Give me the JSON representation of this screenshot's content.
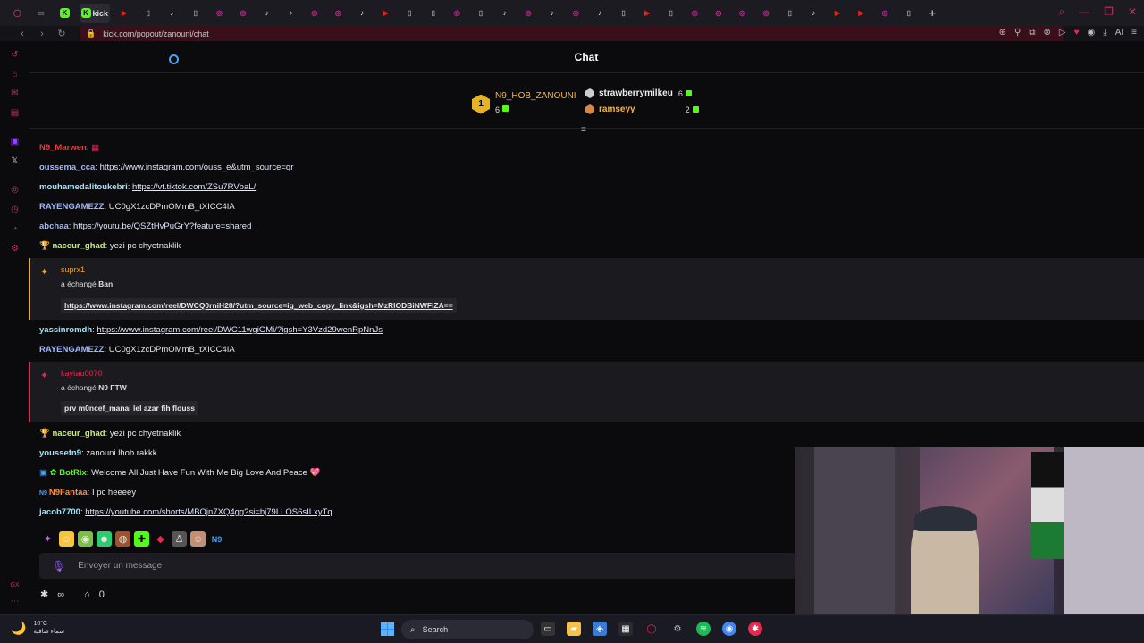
{
  "browser": {
    "active_tab_label": "kick",
    "url": "kick.com/popout/zanouni/chat",
    "tab_icons": [
      "opera-icon",
      "window-icon",
      "kick-icon",
      "kick-icon",
      "youtube-icon",
      "page-icon",
      "tiktok-icon",
      "page-icon",
      "instagram-icon",
      "instagram-icon",
      "tiktok-icon",
      "tiktok-icon",
      "instagram-icon",
      "instagram-icon",
      "tiktok-icon",
      "youtube-icon",
      "page-icon",
      "page-icon",
      "instagram-icon",
      "page-icon",
      "tiktok-icon",
      "instagram-icon",
      "tiktok-icon",
      "instagram-icon",
      "tiktok-icon",
      "page-icon",
      "youtube-icon",
      "page-icon",
      "instagram-icon",
      "instagram-icon",
      "instagram-icon",
      "instagram-icon",
      "page-icon",
      "tiktok-icon",
      "youtube-icon",
      "youtube-icon",
      "instagram-icon",
      "page-icon"
    ]
  },
  "chat": {
    "title": "Chat",
    "leaderboard": {
      "first": {
        "rank": "1",
        "name": "N9_HOB_ZANOUNI",
        "count": "6"
      },
      "second": {
        "name": "strawberrymilkeu",
        "count": "6"
      },
      "third": {
        "name": "ramseyy",
        "count": "2"
      }
    },
    "messages": [
      {
        "user": "N9_Marwen",
        "sep": ":",
        "text": "",
        "color": "#e63c3c"
      },
      {
        "user": "oussema_cca",
        "sep": ": ",
        "text": "https://www.instagram.com/ouss_e&utm_source=qr",
        "color": "#9fb6ff",
        "link": true
      },
      {
        "user": "mouhamedalitoukebri",
        "sep": ": ",
        "text": "https://vt.tiktok.com/ZSu7RVbaL/",
        "color": "#9fe3ff",
        "link": true
      },
      {
        "user": "RAYENGAMEZZ",
        "sep": ": ",
        "text": "UC0gX1zcDPmOMmB_tXICC4IA",
        "color": "#9fb6ff"
      },
      {
        "user": "abchaa",
        "sep": ": ",
        "text": "https://youtu.be/QSZtHvPuGrY?feature=shared",
        "color": "#9fb6ff",
        "link": true
      },
      {
        "user": "naceur_ghad",
        "sep": ": ",
        "text": "yezi pc chyetnaklik",
        "color": "#c7f26b"
      },
      {
        "user": "yassinromdh",
        "sep": ": ",
        "text": "https://www.instagram.com/reel/DWC11wgiGMi/?igsh=Y3Vzd29wenRpNnJs",
        "color": "#9fe3ff",
        "link": true
      },
      {
        "user": "RAYENGAMEZZ",
        "sep": ": ",
        "text": "UC0gX1zcDPmOMmB_tXICC4IA",
        "color": "#9fb6ff"
      },
      {
        "user": "naceur_ghad",
        "sep": ": ",
        "text": "yezi pc chyetnaklik",
        "color": "#c7f26b"
      },
      {
        "user": "youssefn9",
        "sep": ": ",
        "text": "zanouni lhob rakkk",
        "color": "#9fe3ff"
      },
      {
        "user": "BotRix",
        "sep": ": ",
        "text": "Welcome All Just Have Fun With Me Big Love And Peace 💖",
        "color": "#53fc18"
      },
      {
        "user": "N9Fantaa",
        "sep": ": ",
        "text": "I pc heeeey",
        "color": "#ff8a3d"
      },
      {
        "user": "jacob7700",
        "sep": ": ",
        "text": "https://youtube.com/shorts/MBOjn7XQ4gg?si=bj79LLOS6sILxyTq",
        "color": "#9fe3ff",
        "link": true
      }
    ],
    "events": [
      {
        "user": "suprx1",
        "action_prefix": "a échangé ",
        "action_item": "Ban",
        "content": "https://www.instagram.com/reel/DWCQ0rniH28/?utm_source=ig_web_copy_link&igsh=MzRlODBiNWFlZA==",
        "color": "#f5a623"
      },
      {
        "user": "kaytau0070",
        "action_prefix": "a échangé ",
        "action_item": "N9 FTW",
        "content": "prv m0ncef_manai lel azar fih flouss",
        "color": "#e6294f"
      }
    ],
    "input_placeholder": "Envoyer un message",
    "bottom": {
      "infinity": "∞",
      "points": "0"
    }
  },
  "taskbar": {
    "temperature": "10°C",
    "weather_desc": "سماء صافية",
    "search_label": "Search"
  },
  "colors": {
    "accent": "#53fc18",
    "brand_red": "#c2305a"
  }
}
